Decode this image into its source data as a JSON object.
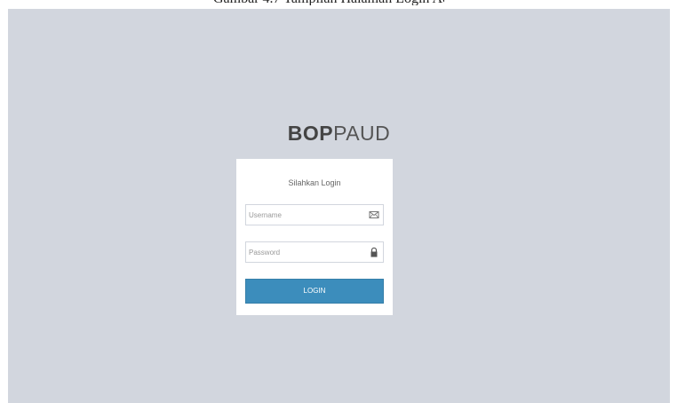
{
  "app": {
    "logo_bold": "BOP",
    "logo_light": "PAUD"
  },
  "login": {
    "message": "Silahkan Login",
    "username_placeholder": "Username",
    "password_placeholder": "Password",
    "login_button": "LOGIN"
  },
  "icons": {
    "username": "envelope-icon",
    "password": "lock-icon"
  },
  "colors": {
    "page_background": "#d2d6de",
    "box_background": "#ffffff",
    "button_background": "#3c8dbc",
    "button_text": "#ffffff"
  }
}
